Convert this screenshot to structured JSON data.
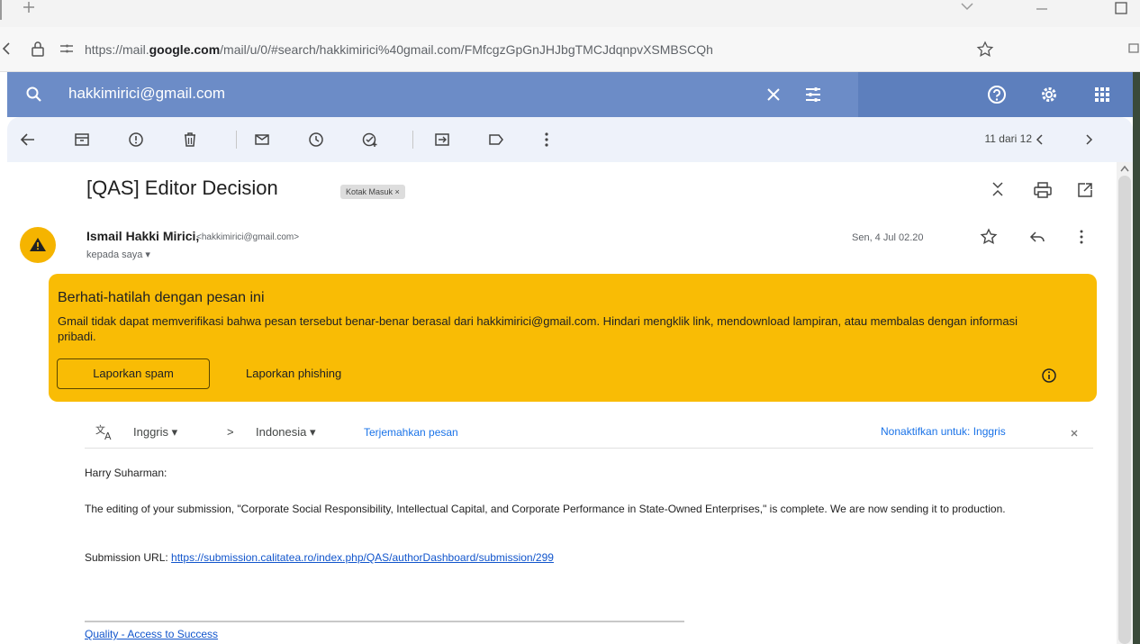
{
  "browser": {
    "url_prefix": "https://mail.",
    "url_host": "google.com",
    "url_rest": "/mail/u/0/#search/hakkimirici%40gmail.com/FMfcgzGpGnJHJbgTMCJdqnpvXSMBSCQh",
    "icons": [
      "plus-icon",
      "chevron-down-icon",
      "minimize-icon",
      "maximize-icon",
      "back-icon",
      "lock-icon",
      "site-settings-icon",
      "favorite-star-icon",
      "extension-icon"
    ]
  },
  "search": {
    "query": "hakkimirici@gmail.com",
    "icons": [
      "search-icon",
      "clear-icon",
      "filter-icon",
      "help-icon",
      "settings-icon",
      "apps-grid-icon"
    ]
  },
  "toolbar": {
    "count": "11 dari 12",
    "icons": [
      "back-arrow-icon",
      "archive-icon",
      "report-spam-icon",
      "delete-icon",
      "mark-unread-icon",
      "snooze-icon",
      "add-task-icon",
      "move-to-icon",
      "label-icon",
      "more-vert-icon",
      "prev-icon",
      "next-icon"
    ]
  },
  "email": {
    "subject": "[QAS] Editor Decision",
    "label": "Kotak Masuk ×",
    "sender_name": "Ismail Hakki Mirici,",
    "sender_email": "<hakkimirici@gmail.com>",
    "to": "kepada saya ▾",
    "date": "Sen, 4 Jul 02.20"
  },
  "warning": {
    "title": "Berhati-hatilah dengan pesan ini",
    "body": "Gmail tidak dapat memverifikasi bahwa pesan tersebut benar-benar berasal dari hakkimirici@gmail.com. Hindari mengklik link, mendownload lampiran, atau membalas dengan informasi pribadi.",
    "spam_button": "Laporkan spam",
    "phishing_button": "Laporkan phishing",
    "color": "#f9bc05"
  },
  "translate": {
    "from": "Inggris ▾",
    "arrow": ">",
    "to": "Indonesia ▾",
    "translate_link": "Terjemahkan pesan",
    "disable": "Nonaktifkan untuk: Inggris"
  },
  "body": {
    "greeting": "Harry Suharman:",
    "paragraph": "The editing of your submission, \"Corporate Social Responsibility, Intellectual Capital, and Corporate Performance in State-Owned Enterprises,\" is complete. We are now sending it to production.",
    "url_label": "Submission URL:",
    "url": "https://submission.calitatea.ro/index.php/QAS/authorDashboard/submission/299",
    "footer_link": "Quality - Access to Success"
  },
  "colors": {
    "searchbar": "#5d7fbd",
    "toolbar": "#eef2fa",
    "link": "#1155cc"
  }
}
